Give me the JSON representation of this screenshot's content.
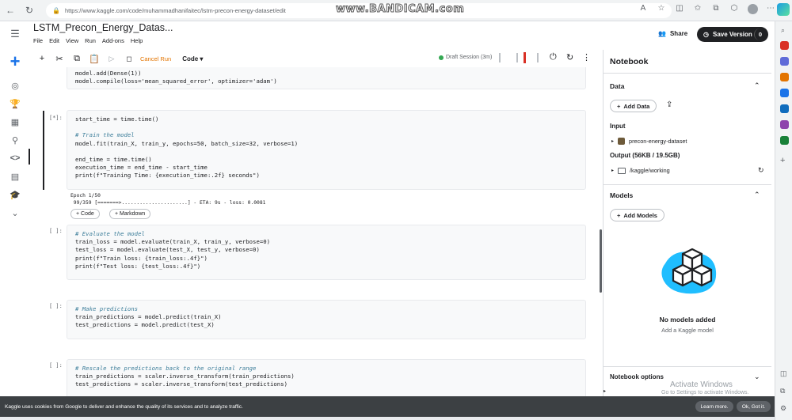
{
  "browser": {
    "url": "https://www.kaggle.com/code/muhammadhanifaitec/lstm-precon-energy-dataset/edit",
    "watermark": "www.BANDICAM.com"
  },
  "header": {
    "title": "LSTM_Precon_Energy_Datas...",
    "menu": [
      "File",
      "Edit",
      "View",
      "Run",
      "Add-ons",
      "Help"
    ],
    "share_label": "Share",
    "save_label": "Save Version",
    "save_count": "0"
  },
  "toolbar": {
    "cancel_run": "Cancel Run",
    "cell_type": "Code",
    "session": "Draft Session (3m)"
  },
  "cells": {
    "cell0": {
      "line1": "model.add(Dense(1))",
      "line2": "model.compile(loss='mean_squared_error', optimizer='adam')"
    },
    "cell1": {
      "prompt": "[*]:",
      "lines": [
        "start_time = time.time()",
        "",
        "# Train the model",
        "model.fit(train_X, train_y, epochs=50, batch_size=32, verbose=1)",
        "",
        "end_time = time.time()",
        "execution_time = end_time - start_time",
        "print(f\"Training Time: {execution_time:.2f} seconds\")"
      ],
      "output1": "Epoch 1/50",
      "output2": " 99/359 [=======>......................] - ETA: 9s - loss: 0.0081"
    },
    "add_code": "+ Code",
    "add_markdown": "+ Markdown",
    "cell2": {
      "prompt": "[ ]:",
      "lines": [
        "# Evaluate the model",
        "train_loss = model.evaluate(train_X, train_y, verbose=0)",
        "test_loss = model.evaluate(test_X, test_y, verbose=0)",
        "print(f\"Train loss: {train_loss:.4f}\")",
        "print(f\"Test loss: {test_loss:.4f}\")"
      ]
    },
    "cell3": {
      "prompt": "[ ]:",
      "lines": [
        "# Make predictions",
        "train_predictions = model.predict(train_X)",
        "test_predictions = model.predict(test_X)"
      ]
    },
    "cell4": {
      "prompt": "[ ]:",
      "lines": [
        "# Rescale the predictions back to the original range",
        "train_predictions = scaler.inverse_transform(train_predictions)",
        "test_predictions = scaler.inverse_transform(test_predictions)"
      ]
    }
  },
  "panel": {
    "title": "Notebook",
    "data_section": "Data",
    "add_data": "Add Data",
    "input_label": "Input",
    "input_item": "precon-energy-dataset",
    "output_label": "Output (56KB / 19.5GB)",
    "output_item": "/kaggle/working",
    "models_section": "Models",
    "add_models": "Add Models",
    "no_models": "No models added",
    "no_models_sub": "Add a Kaggle model",
    "options": "Notebook options"
  },
  "os": {
    "activate": "Activate Windows",
    "activate_sub": "Go to Settings to activate Windows."
  },
  "cookie": {
    "text": "Kaggle uses cookies from Google to deliver and enhance the quality of its services and to analyze traffic.",
    "learn_more": "Learn more.",
    "ok": "Ok, Got it."
  },
  "colors": {
    "accent": "#1a73e8",
    "dark": "#202124",
    "cancel": "#e37400",
    "session": "#34a853",
    "models_blob": "#20beff"
  }
}
